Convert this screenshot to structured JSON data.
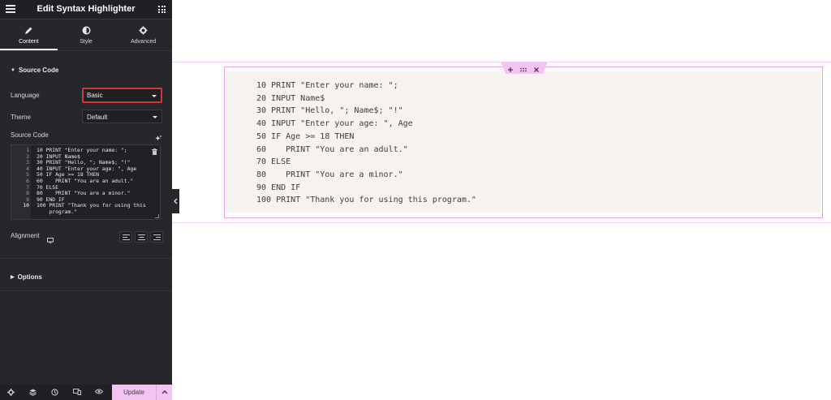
{
  "panel": {
    "title": "Edit Syntax Highlighter",
    "tabs": [
      {
        "label": "Content",
        "icon": "pencil-icon",
        "active": true
      },
      {
        "label": "Style",
        "icon": "half-circle-icon",
        "active": false
      },
      {
        "label": "Advanced",
        "icon": "gear-icon",
        "active": false
      }
    ],
    "section_source": "Source Code",
    "language": {
      "label": "Language",
      "value": "Basic"
    },
    "theme": {
      "label": "Theme",
      "value": "Default"
    },
    "source_code_label": "Source Code",
    "editor_lines": [
      {
        "num": "1",
        "text": "10 PRINT \"Enter your name: \";"
      },
      {
        "num": "2",
        "text": "20 INPUT Name$"
      },
      {
        "num": "3",
        "text": "30 PRINT \"Hello, \"; Name$; \"!\""
      },
      {
        "num": "4",
        "text": "40 INPUT \"Enter your age: \", Age"
      },
      {
        "num": "5",
        "text": "50 IF Age >= 18 THEN"
      },
      {
        "num": "6",
        "text": "60    PRINT \"You are an adult.\""
      },
      {
        "num": "7",
        "text": "70 ELSE"
      },
      {
        "num": "8",
        "text": "80    PRINT \"You are a minor.\""
      },
      {
        "num": "9",
        "text": "90 END IF"
      },
      {
        "num": "10",
        "text": "100 PRINT \"Thank you for using this"
      },
      {
        "num": "",
        "text": "    program.\""
      }
    ],
    "alignment_label": "Alignment",
    "section_options": "Options",
    "footer": {
      "update_label": "Update",
      "icons": [
        "settings-icon",
        "layers-icon",
        "history-icon",
        "responsive-icon",
        "preview-eye-icon"
      ]
    }
  },
  "canvas": {
    "code_lines": [
      "10 PRINT \"Enter your name: \";",
      "20 INPUT Name$",
      "30 PRINT \"Hello, \"; Name$; \"!\"",
      "40 INPUT \"Enter your age: \", Age",
      "50 IF Age >= 18 THEN",
      "60    PRINT \"You are an adult.\"",
      "70 ELSE",
      "80    PRINT \"You are a minor.\"",
      "90 END IF",
      "100 PRINT \"Thank you for using this program.\""
    ],
    "handle": {
      "add": "+",
      "move": "⠿",
      "close": "✕"
    }
  },
  "colors": {
    "panel_bg": "#26272b",
    "accent_pink": "#f3c4f2",
    "frame_pink": "#e7a1e6",
    "highlight_red": "#d23737",
    "code_bg": "#f5f2f0"
  }
}
